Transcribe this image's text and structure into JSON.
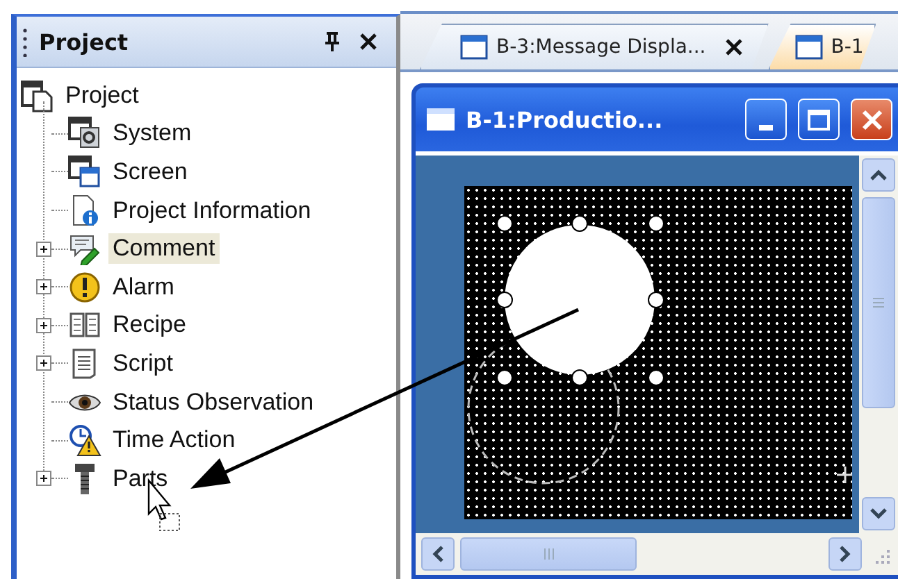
{
  "project_panel": {
    "title": "Project",
    "tree": {
      "label": "Project",
      "children": [
        {
          "label": "System",
          "kind": "leaf",
          "selected": false
        },
        {
          "label": "Screen",
          "kind": "leaf",
          "selected": false
        },
        {
          "label": "Project Information",
          "kind": "leaf",
          "selected": false
        },
        {
          "label": "Comment",
          "kind": "group",
          "expanded": false,
          "selected": true
        },
        {
          "label": "Alarm",
          "kind": "group",
          "expanded": false,
          "selected": false
        },
        {
          "label": "Recipe",
          "kind": "group",
          "expanded": false,
          "selected": false
        },
        {
          "label": "Script",
          "kind": "group",
          "expanded": false,
          "selected": false
        },
        {
          "label": "Status Observation",
          "kind": "leaf",
          "selected": false
        },
        {
          "label": "Time Action",
          "kind": "leaf",
          "selected": false
        },
        {
          "label": "Parts",
          "kind": "group",
          "expanded": false,
          "selected": false
        }
      ]
    }
  },
  "tabs": [
    {
      "label": "B-3:Message Displa...",
      "selected": false,
      "closable": true
    },
    {
      "label": "B-1",
      "selected": true,
      "closable": false
    }
  ],
  "screen_window": {
    "title": "B-1:Productio...",
    "canvas": {
      "shapes": [
        {
          "kind": "circle",
          "selected": true
        },
        {
          "kind": "drag-outline"
        }
      ]
    }
  }
}
